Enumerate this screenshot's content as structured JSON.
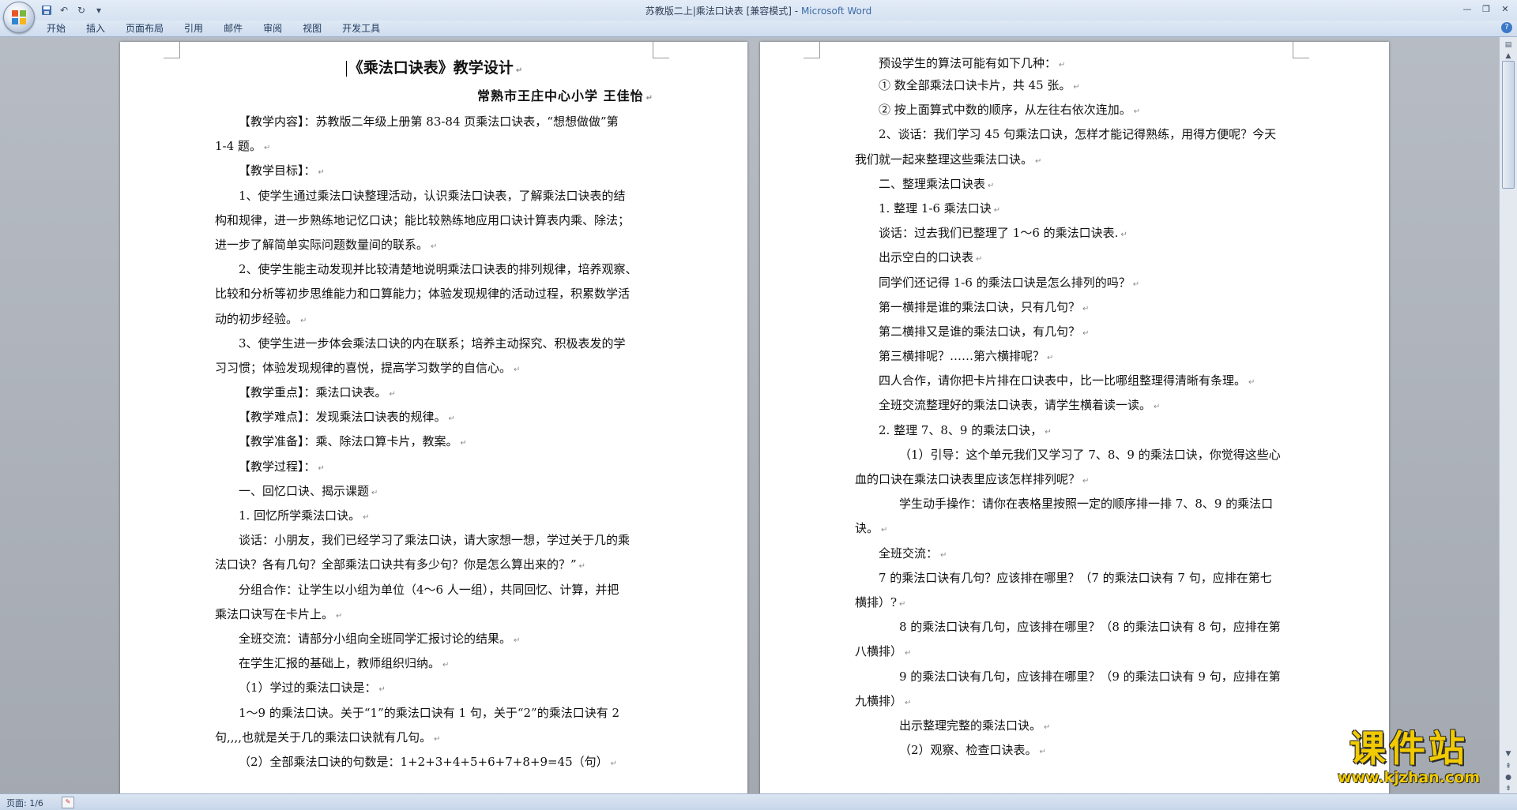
{
  "window": {
    "title_doc": "苏教版二上|乘法口诀表 [兼容模式]",
    "title_sep": " - ",
    "title_app": "Microsoft Word"
  },
  "ribbon": {
    "tabs": [
      "开始",
      "插入",
      "页面布局",
      "引用",
      "邮件",
      "审阅",
      "视图",
      "开发工具"
    ]
  },
  "status": {
    "page": "页面: 1/6"
  },
  "page1": {
    "title": "《乘法口诀表》教学设计",
    "author": "常熟市王庄中心小学   王佳怡",
    "lines": [
      "【教学内容】：苏教版二年级上册第 83-84 页乘法口诀表，“想想做做”第",
      "1-4 题。",
      "【教学目标】：",
      "1、使学生通过乘法口诀整理活动，认识乘法口诀表，了解乘法口诀表的结",
      "构和规律，进一步熟练地记忆口诀；能比较熟练地应用口诀计算表内乘、除法；",
      "进一步了解简单实际问题数量间的联系。",
      "2、使学生能主动发现并比较清楚地说明乘法口诀表的排列规律，培养观察、",
      "比较和分析等初步思维能力和口算能力；体验发现规律的活动过程，积累数学活",
      "动的初步经验。",
      "3、使学生进一步体会乘法口诀的内在联系；培养主动探究、积极表发的学",
      "习习惯；体验发现规律的喜悦，提高学习数学的自信心。",
      "【教学重点】：乘法口诀表。",
      "【教学难点】：发现乘法口诀表的规律。",
      "【教学准备】：乘、除法口算卡片，教案。",
      "【教学过程】：",
      "一、回忆口诀、揭示课题",
      "1. 回忆所学乘法口诀。",
      "谈话：小朋友，我们已经学习了乘法口诀，请大家想一想，学过关于几的乘",
      "法口诀？各有几句？全部乘法口诀共有多少句？你是怎么算出来的？”",
      "分组合作：让学生以小组为单位（4～6 人一组），共同回忆、计算，并把",
      "乘法口诀写在卡片上。",
      "全班交流：请部分小组向全班同学汇报讨论的结果。",
      "在学生汇报的基础上，教师组织归纳。",
      "（1）学过的乘法口诀是：",
      "1～9 的乘法口诀。关于“1”的乘法口诀有 1 句，关于“2”的乘法口诀有 2",
      "句,,,,也就是关于几的乘法口诀就有几句。",
      "（2）全部乘法口诀的句数是：1+2+3+4+5+6+7+8+9=45（句）"
    ]
  },
  "page2": {
    "lines": [
      "预设学生的算法可能有如下几种：",
      "①  数全部乘法口诀卡片，共 45 张。",
      "②    按上面算式中数的顺序，从左往右依次连加。",
      "2、谈话：我们学习 45 句乘法口诀，怎样才能记得熟练，用得方便呢？今天",
      "我们就一起来整理这些乘法口诀。",
      "二、整理乘法口诀表",
      " 1. 整理 1-6 乘法口诀",
      "谈话：过去我们已整理了 1～6 的乘法口诀表.",
      "出示空白的口诀表",
      "同学们还记得 1-6 的乘法口诀是怎么排列的吗？",
      "第一横排是谁的乘法口诀，只有几句？",
      "第二横排又是谁的乘法口诀，有几句？",
      "第三横排呢？……第六横排呢？",
      "四人合作，请你把卡片排在口诀表中，比一比哪组整理得清晰有条理。",
      "全班交流整理好的乘法口诀表，请学生横着读一读。",
      "2. 整理 7、8、9 的乘法口诀，",
      "（1）引导：这个单元我们又学习了 7、8、9 的乘法口诀，你觉得这些心",
      "血的口诀在乘法口诀表里应该怎样排列呢？",
      "学生动手操作：请你在表格里按照一定的顺序排一排 7、8、9 的乘法口",
      "诀。",
      "全班交流：",
      "7 的乘法口诀有几句？应该排在哪里？（7 的乘法口诀有 7 句，应排在第七",
      "横排）?",
      "8 的乘法口诀有几句，应该排在哪里？（8 的乘法口诀有 8 句，应排在第",
      "八横排）",
      "9 的乘法口诀有几句，应该排在哪里？（9 的乘法口诀有 9 句，应排在第",
      "九横排）",
      "出示整理完整的乘法口诀。",
      "（2）观察、检查口诀表。"
    ]
  },
  "watermark": {
    "name": "课件站",
    "url": "www.kjzhan.com"
  },
  "colors": {
    "ribbon": "#d6e2f1",
    "workspace": "#a9adb4",
    "watermark": "#f1ca00"
  }
}
